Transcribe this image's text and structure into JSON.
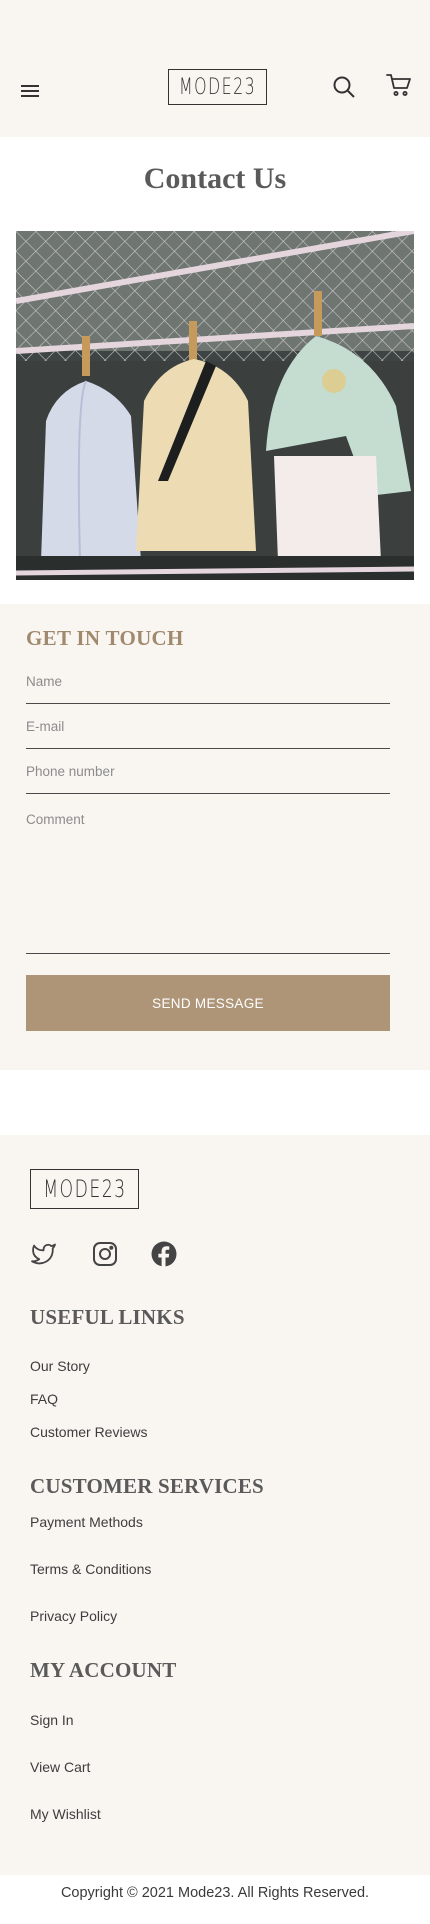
{
  "header": {
    "logo_text": "MODE23",
    "menu_icon": "hamburger-menu-icon",
    "search_icon": "search-icon",
    "cart_icon": "cart-icon"
  },
  "page": {
    "title": "Contact Us"
  },
  "hero_image": {
    "icon": "mannequins-clothing-photo"
  },
  "form": {
    "title": "GET IN TOUCH",
    "name_placeholder": "Name",
    "email_placeholder": "E-mail",
    "phone_placeholder": "Phone number",
    "comment_placeholder": "Comment",
    "submit_label": "SEND MESSAGE"
  },
  "footer": {
    "logo_text": "MODE23",
    "social": [
      "twitter-icon",
      "instagram-icon",
      "facebook-icon"
    ],
    "useful_links": {
      "heading": "USEFUL LINKS",
      "items": [
        "Our Story",
        "FAQ",
        "Customer Reviews"
      ]
    },
    "customer_services": {
      "heading": "CUSTOMER SERVICES",
      "items": [
        "Payment Methods",
        "Terms & Conditions",
        "Privacy Policy"
      ]
    },
    "my_account": {
      "heading": "MY ACCOUNT",
      "items": [
        "Sign In",
        "View Cart",
        "My Wishlist"
      ]
    },
    "copyright": "Copyright © 2021 Mode23. All Rights Reserved."
  },
  "colors": {
    "background_cream": "#f9f6f2",
    "accent_tan": "#ae9578",
    "heading_tan": "#a1896e",
    "text_dark": "#3f3f3f"
  }
}
